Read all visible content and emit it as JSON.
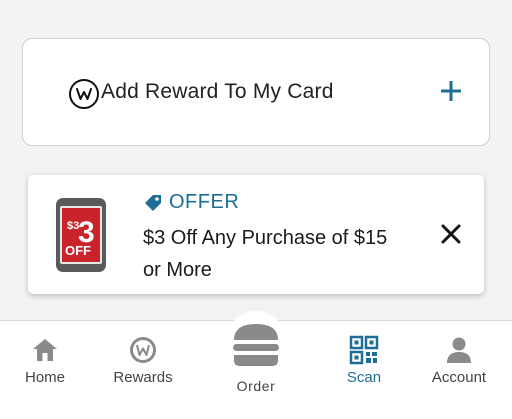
{
  "reward_card": {
    "label": "Add Reward To My Card",
    "logo_icon": "brand-w-logo",
    "action_icon": "plus-icon",
    "accent_color": "#1d6e96"
  },
  "offer": {
    "tag_label": "OFFER",
    "tag_icon": "price-tag-icon",
    "description": "$3 Off Any Purchase of $15 or More",
    "image": {
      "icon": "phone-coupon-image",
      "amount_text": "$3",
      "off_text": "OFF"
    },
    "dismiss_icon": "close-icon"
  },
  "nav": {
    "items": [
      {
        "label": "Home",
        "icon": "home-icon",
        "active": false
      },
      {
        "label": "Rewards",
        "icon": "rewards-icon",
        "active": false
      },
      {
        "label": "Order",
        "icon": "burger-icon",
        "active": false
      },
      {
        "label": "Scan",
        "icon": "qr-code-icon",
        "active": true
      },
      {
        "label": "Account",
        "icon": "account-icon",
        "active": false
      }
    ],
    "active_color": "#1d6e96",
    "inactive_color": "#8a8a8a"
  }
}
